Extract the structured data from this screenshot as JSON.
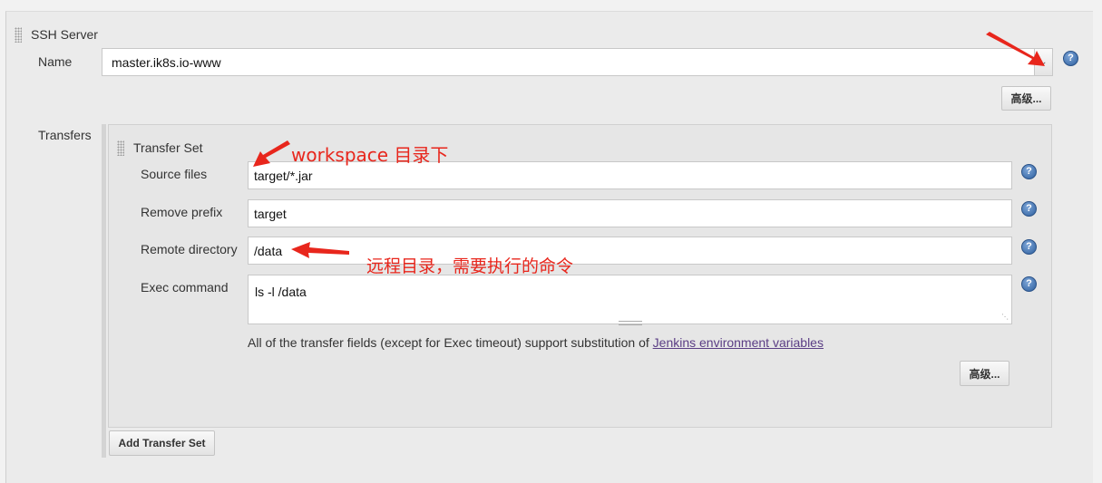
{
  "ssh_server": {
    "section_title": "SSH Server",
    "name_label": "Name",
    "name_value": "master.ik8s.io-www",
    "advanced_label": "高级..."
  },
  "transfers": {
    "label": "Transfers",
    "set_title": "Transfer Set",
    "source_files_label": "Source files",
    "source_files_value": "target/*.jar",
    "remove_prefix_label": "Remove prefix",
    "remove_prefix_value": "target",
    "remote_directory_label": "Remote directory",
    "remote_directory_value": "/data",
    "exec_command_label": "Exec command",
    "exec_command_value": "ls -l /data",
    "note_prefix": "All of the transfer fields (except for Exec timeout) support substitution of ",
    "note_link": "Jenkins environment variables",
    "advanced_label": "高级...",
    "add_button": "Add Transfer Set"
  },
  "annotations": {
    "workspace_note": "workspace 目录下",
    "remote_note": "远程目录，需要执行的命令",
    "color": "#e8261c"
  },
  "colors": {
    "help_icon": "#2d5f9e",
    "link": "#5b3e85"
  }
}
